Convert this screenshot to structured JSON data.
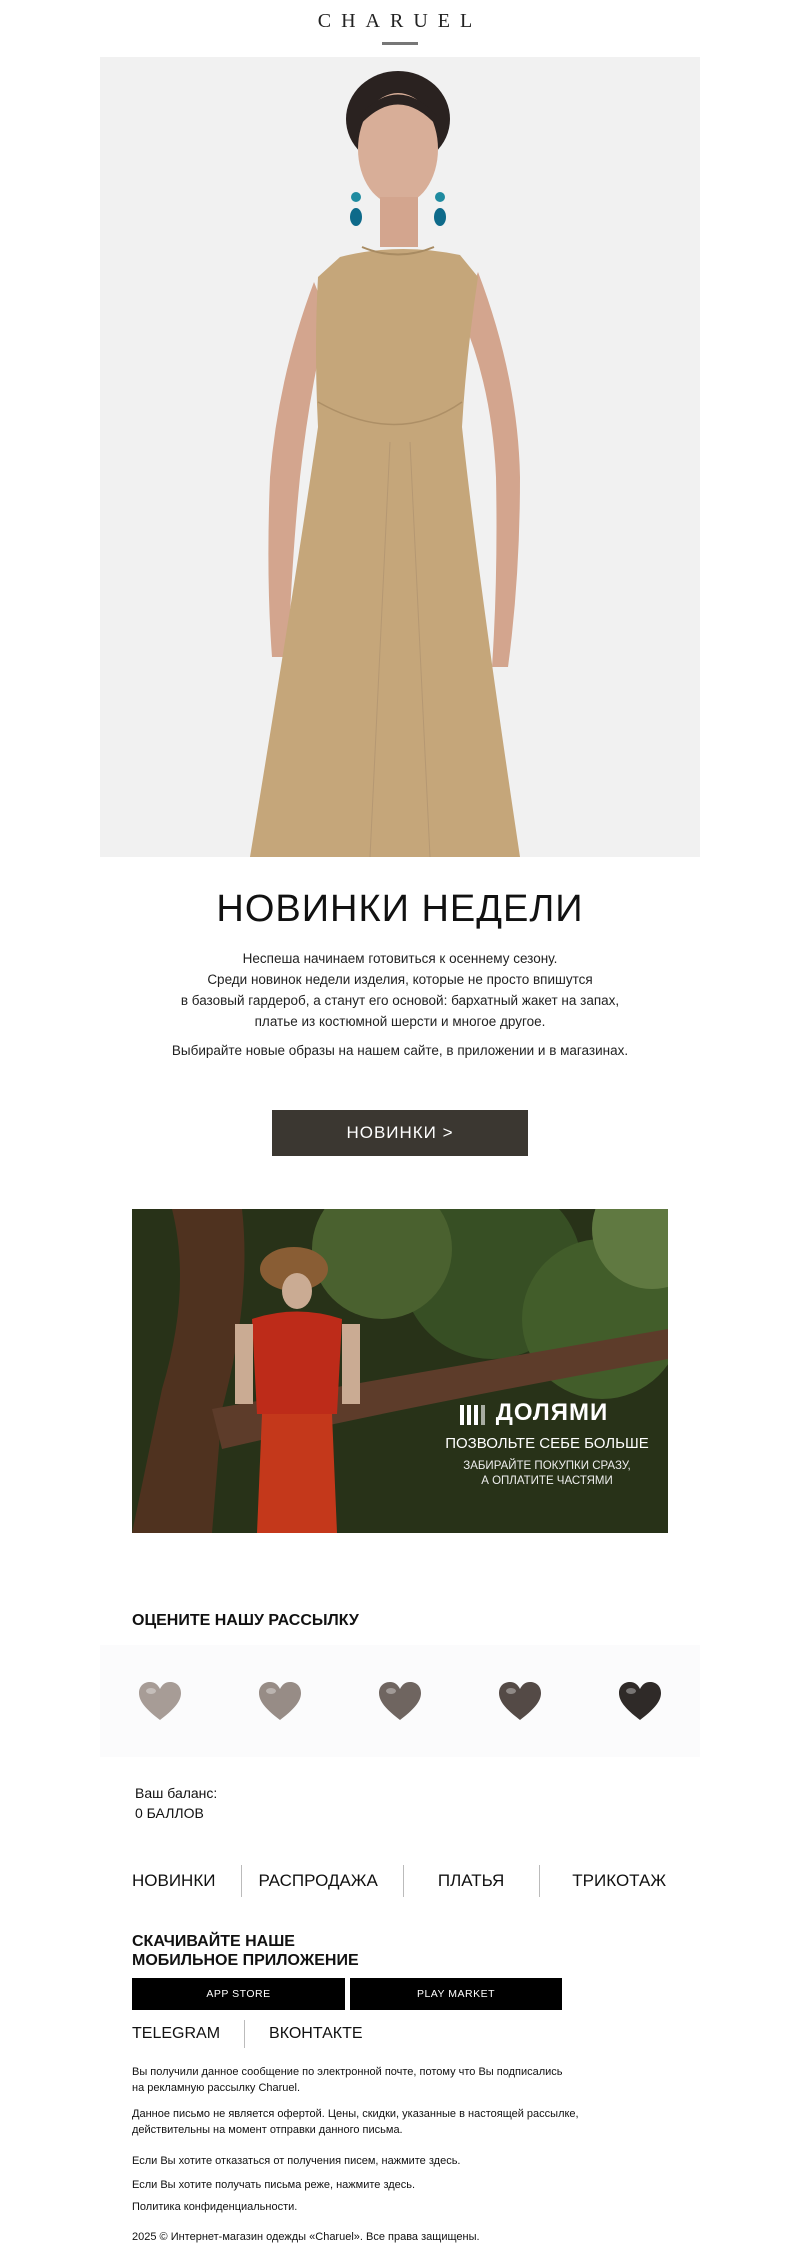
{
  "header": {
    "logo": "CHARUEL"
  },
  "hero": {
    "image": "woman-in-beige-sleeveless-dress",
    "background_color": "#f1f1f1",
    "dress_color": "#c5a67a"
  },
  "intro": {
    "headline": "НОВИНКИ НЕДЕЛИ",
    "paragraph_lines": [
      "Неспеша начинаем готовиться к осеннему сезону.",
      "Среди новинок недели изделия, которые не просто впишутся",
      "в базовый гардероб, а станут его основой: бархатный жакет на запах,",
      "платье из костюмной шерсти и многое другое."
    ],
    "paragraph2": "Выбирайте новые образы на нашем сайте, в приложении и в магазинах.",
    "cta_label": "НОВИНКИ >",
    "cta_color": "#3b3731"
  },
  "banner": {
    "brand": "ДОЛЯМИ",
    "headline": "ПОЗВОЛЬТЕ СЕБЕ БОЛЬШЕ",
    "sub_lines": [
      "ЗАБИРАЙТЕ ПОКУПКИ СРАЗУ,",
      "А ОПЛАТИТЕ ЧАСТЯМИ"
    ],
    "icon": "dolyami-bars-icon"
  },
  "rating": {
    "title": "ОЦЕНИТЕ НАШУ РАССЫЛКУ",
    "hearts": [
      {
        "name": "heart-rating-1-icon",
        "color": "#a79c96"
      },
      {
        "name": "heart-rating-2-icon",
        "color": "#978c86"
      },
      {
        "name": "heart-rating-3-icon",
        "color": "#6f6560"
      },
      {
        "name": "heart-rating-4-icon",
        "color": "#544a46"
      },
      {
        "name": "heart-rating-5-icon",
        "color": "#2f2a28"
      }
    ]
  },
  "balance": {
    "label": "Ваш баланс:",
    "value": "0 БАЛЛОВ"
  },
  "nav": {
    "items": [
      "НОВИНКИ",
      "РАСПРОДАЖА",
      "ПЛАТЬЯ",
      "ТРИКОТАЖ"
    ]
  },
  "app": {
    "title_line1": "СКАЧИВАЙТЕ НАШЕ",
    "title_line2": "МОБИЛЬНОЕ ПРИЛОЖЕНИЕ",
    "app_store": "APP STORE",
    "play_market": "PLAY MARKET"
  },
  "social": {
    "telegram": "TELEGRAM",
    "vk": "ВКОНТАКТЕ"
  },
  "footer": {
    "notice_lines": [
      "Вы получили данное сообщение по электронной почте, потому что Вы подписались",
      "на рекламную рассылку Charuel."
    ],
    "offer_lines": [
      "Данное письмо не является офертой. Цены, скидки, указанные в настоящей рассылке,",
      "действительны на момент отправки данного письма."
    ],
    "unsubscribe": "Если Вы хотите отказаться от получения писем, нажмите здесь.",
    "less_often": "Если Вы хотите получать письма реже, нажмите здесь.",
    "privacy": "Политика конфиденциальности.",
    "copyright": "2025 © Интернет-магазин одежды «Charuel». Все права защищены."
  }
}
